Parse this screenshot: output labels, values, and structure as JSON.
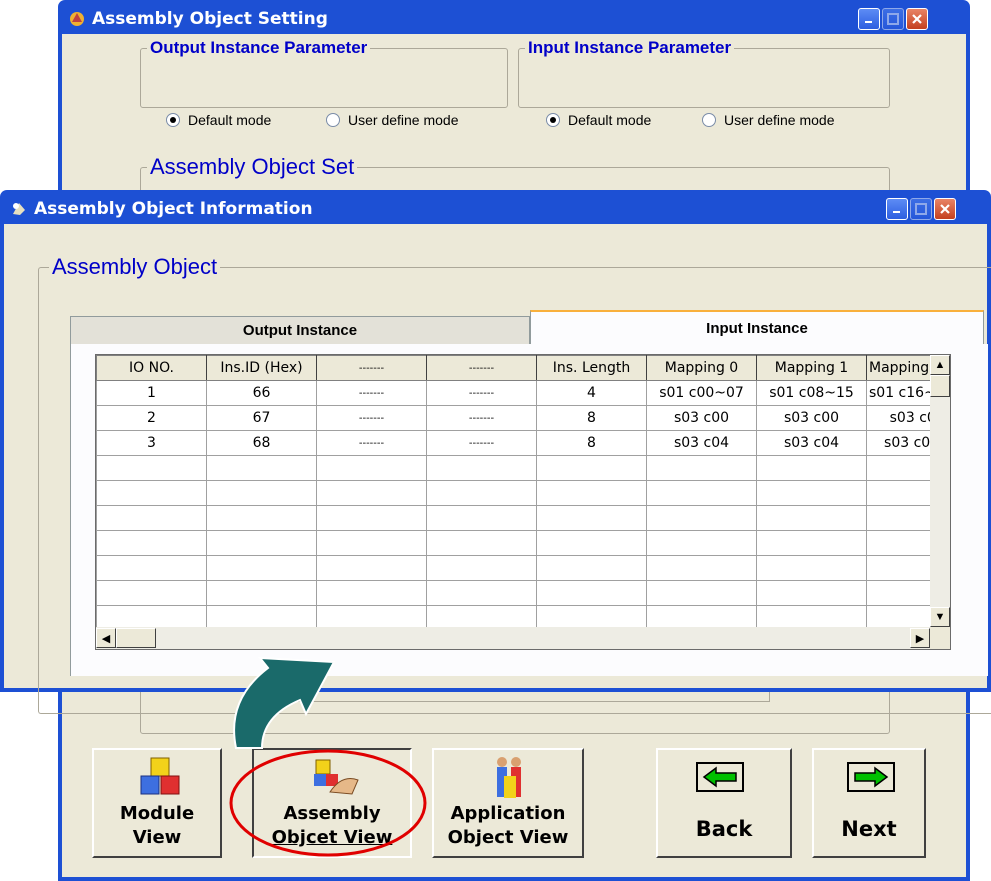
{
  "back_window": {
    "title": "Assembly Object Setting",
    "output_group": {
      "legend": "Output Instance Parameter",
      "option_default": "Default mode",
      "option_user": "User define mode"
    },
    "input_group": {
      "legend": "Input Instance Parameter",
      "option_default": "Default mode",
      "option_user": "User define mode"
    },
    "set_group": {
      "legend": "Assembly Object Set"
    }
  },
  "front_window": {
    "title": "Assembly Object Information",
    "group_legend": "Assembly Object",
    "tabs": [
      {
        "label": "Output Instance",
        "active": false
      },
      {
        "label": "Input Instance",
        "active": true
      }
    ],
    "table": {
      "headers": [
        "IO NO.",
        "Ins.ID (Hex)",
        "-------",
        "-------",
        "Ins. Length",
        "Mapping 0",
        "Mapping 1",
        "Mapping"
      ],
      "rows": [
        [
          "1",
          "66",
          "-------",
          "-------",
          "4",
          "s01 c00~07",
          "s01 c08~15",
          "s01 c16~"
        ],
        [
          "2",
          "67",
          "-------",
          "-------",
          "8",
          "s03 c00",
          "s03 c00",
          "s03 c0"
        ],
        [
          "3",
          "68",
          "-------",
          "-------",
          "8",
          "s03 c04",
          "s03 c04",
          "s03 c0!"
        ]
      ]
    }
  },
  "buttons": {
    "module_view": [
      "Module",
      "View"
    ],
    "assembly_view": [
      "Assembly",
      "Objcet View"
    ],
    "application_view": [
      "Application",
      "Object View"
    ],
    "back": "Back",
    "next": "Next"
  },
  "colors": {
    "title_bar": "#1d50d4",
    "window_bg": "#ece9d8",
    "legend_text": "#0000c8",
    "highlight_circle": "#e00000",
    "arrow": "#1a6a6a",
    "nav_arrow": "#00c000"
  }
}
